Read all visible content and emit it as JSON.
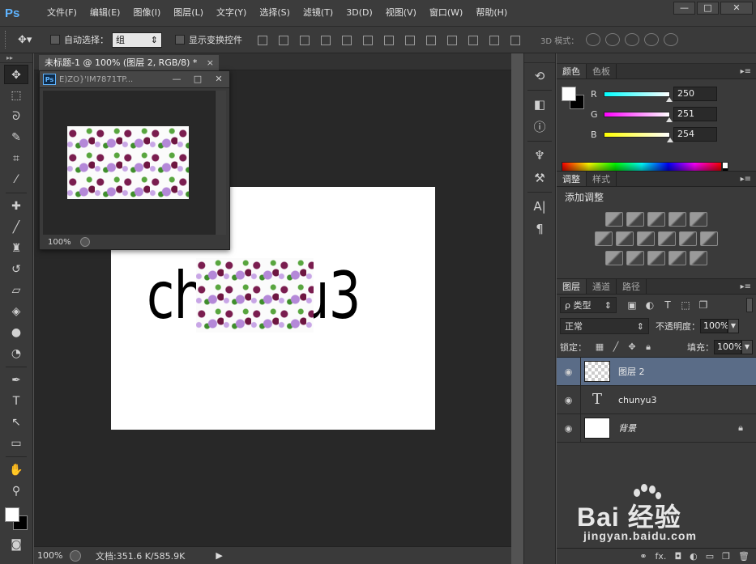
{
  "app": {
    "logo": "Ps"
  },
  "menu": [
    "文件(F)",
    "编辑(E)",
    "图像(I)",
    "图层(L)",
    "文字(Y)",
    "选择(S)",
    "滤镜(T)",
    "3D(D)",
    "视图(V)",
    "窗口(W)",
    "帮助(H)"
  ],
  "window_buttons": {
    "minimize": "—",
    "maximize": "□",
    "close": "✕"
  },
  "options": {
    "auto_select_label": "自动选择：",
    "auto_select_value": "组",
    "show_transform_label": "显示变换控件",
    "mode3d_label": "3D 模式："
  },
  "document": {
    "tab_title": "未标题-1 @ 100% (图层 2, RGB/8) *",
    "tab_close": "×",
    "canvas_text": "chunyu3",
    "status_zoom": "100%",
    "status_info": "文档:351.6 K/585.9K",
    "status_arrow": "▶"
  },
  "float_doc": {
    "title": "E)ZO}'IM7871TP...",
    "ps_badge": "Ps",
    "zoom": "100%",
    "btn_min": "—",
    "btn_max": "□",
    "btn_close": "✕"
  },
  "color_panel": {
    "tabs": [
      "颜色",
      "色板"
    ],
    "menu": "▸≡",
    "channels": [
      {
        "label": "R",
        "value": "250",
        "level": 0.98,
        "gradient": "linear-gradient(to right,#00ffff,#ffffff)"
      },
      {
        "label": "G",
        "value": "251",
        "level": 0.98,
        "gradient": "linear-gradient(to right,#ff00ff,#ffffff)"
      },
      {
        "label": "B",
        "value": "254",
        "level": 0.99,
        "gradient": "linear-gradient(to right,#ffff00,#ffffff)"
      }
    ]
  },
  "adjust_panel": {
    "tabs": [
      "调整",
      "样式"
    ],
    "menu": "▸≡",
    "title": "添加调整"
  },
  "layers_panel": {
    "tabs": [
      "图层",
      "通道",
      "路径"
    ],
    "menu": "▸≡",
    "filter_label": "ρ 类型",
    "blend_mode": "正常",
    "opacity_label": "不透明度：",
    "opacity_value": "100%",
    "lock_label": "锁定：",
    "fill_label": "填充：",
    "fill_value": "100%",
    "layers": [
      {
        "name": "图层 2",
        "selected": true
      },
      {
        "name": "chunyu3",
        "selected": false
      },
      {
        "name": "背景",
        "selected": false
      }
    ],
    "bottom_icons": [
      "⚭",
      "fx.",
      "◘",
      "◐",
      "▭",
      "❐",
      "🗑"
    ]
  },
  "watermark": {
    "brand": "Bai  经验",
    "url": "jingyan.baidu.com"
  },
  "colors": {
    "accent_selected": "#5a6c87",
    "logo": "#5fb4ff"
  }
}
